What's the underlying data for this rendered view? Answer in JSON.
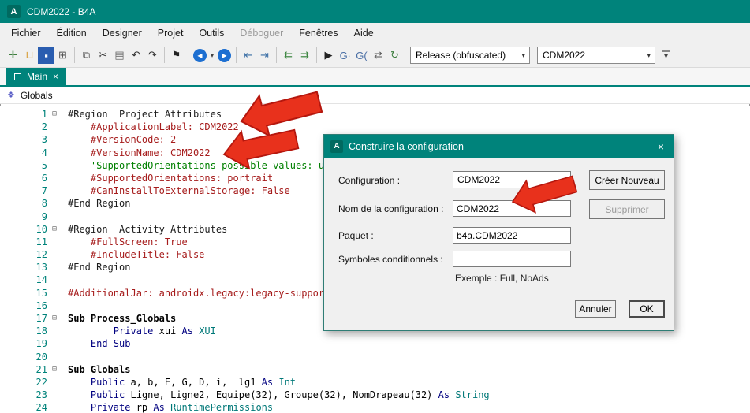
{
  "titlebar": {
    "logo": "A",
    "title": "CDM2022 - B4A"
  },
  "menu": {
    "items": [
      {
        "id": "fichier",
        "label": "Fichier",
        "enabled": true
      },
      {
        "id": "edition",
        "label": "Édition",
        "enabled": true
      },
      {
        "id": "designer",
        "label": "Designer",
        "enabled": true
      },
      {
        "id": "projet",
        "label": "Projet",
        "enabled": true
      },
      {
        "id": "outils",
        "label": "Outils",
        "enabled": true
      },
      {
        "id": "deboguer",
        "label": "Déboguer",
        "enabled": false
      },
      {
        "id": "fenetres",
        "label": "Fenêtres",
        "enabled": true
      },
      {
        "id": "aide",
        "label": "Aide",
        "enabled": true
      }
    ]
  },
  "toolbar": {
    "items": [
      {
        "type": "icon",
        "name": "new-module-icon",
        "glyph": "✛",
        "color": "#3c7d3c"
      },
      {
        "type": "icon",
        "name": "open-icon",
        "glyph": "⊔",
        "color": "#d79b33"
      },
      {
        "type": "icon",
        "name": "save-icon",
        "glyph": "▪",
        "color": "#ffffff",
        "bg": "#2a5db0"
      },
      {
        "type": "icon",
        "name": "modules-icon",
        "glyph": "⊞",
        "color": "#555555"
      },
      {
        "type": "sep"
      },
      {
        "type": "icon",
        "name": "copy-icon",
        "glyph": "⧉",
        "color": "#555555"
      },
      {
        "type": "icon",
        "name": "cut-icon",
        "glyph": "✂",
        "color": "#333333"
      },
      {
        "type": "icon",
        "name": "paste-icon",
        "glyph": "▤",
        "color": "#666666"
      },
      {
        "type": "icon",
        "name": "undo-icon",
        "glyph": "↶",
        "color": "#333333"
      },
      {
        "type": "icon",
        "name": "redo-icon",
        "glyph": "↷",
        "color": "#333333"
      },
      {
        "type": "sep"
      },
      {
        "type": "icon",
        "name": "bookmark-icon",
        "glyph": "⚑",
        "color": "#222222"
      },
      {
        "type": "sep"
      },
      {
        "type": "icon",
        "name": "navigate-back-icon",
        "glyph": "◀",
        "color": "#ffffff",
        "bg": "#1d6fd1",
        "round": true
      },
      {
        "type": "icon",
        "name": "back-dropdown-icon",
        "glyph": "▾",
        "color": "#444444",
        "small": true
      },
      {
        "type": "icon",
        "name": "navigate-forward-icon",
        "glyph": "▶",
        "color": "#ffffff",
        "bg": "#1d6fd1",
        "round": true
      },
      {
        "type": "sep"
      },
      {
        "type": "icon",
        "name": "outdent-icon",
        "glyph": "⇤",
        "color": "#3a6ea5"
      },
      {
        "type": "icon",
        "name": "indent-icon",
        "glyph": "⇥",
        "color": "#3a6ea5"
      },
      {
        "type": "sep"
      },
      {
        "type": "icon",
        "name": "comment-icon",
        "glyph": "⇇",
        "color": "#2e7d32"
      },
      {
        "type": "icon",
        "name": "uncomment-icon",
        "glyph": "⇉",
        "color": "#2e7d32"
      },
      {
        "type": "sep"
      },
      {
        "type": "icon",
        "name": "run-icon",
        "glyph": "▶",
        "color": "#222222"
      },
      {
        "type": "icon",
        "name": "goto-event-icon",
        "glyph": "G∙",
        "color": "#4a6fa5"
      },
      {
        "type": "icon",
        "name": "goto-sub-icon",
        "glyph": "G(",
        "color": "#4a6fa5"
      },
      {
        "type": "icon",
        "name": "switch-module-icon",
        "glyph": "⇄",
        "color": "#555555"
      },
      {
        "type": "icon",
        "name": "rebuild-icon",
        "glyph": "↻",
        "color": "#3a7d3c"
      },
      {
        "type": "combo",
        "name": "build-configuration-select",
        "value": "Release (obfuscated)",
        "width": 152
      },
      {
        "type": "combo",
        "name": "module-select",
        "value": "CDM2022",
        "width": 150
      },
      {
        "type": "overflow",
        "name": "toolbar-overflow-button",
        "glyph": "▾"
      }
    ]
  },
  "tabs": {
    "items": [
      {
        "id": "main",
        "label": "Main",
        "close": "×",
        "active": true
      }
    ]
  },
  "navbar": {
    "label": "Globals"
  },
  "editor": {
    "lines": [
      {
        "n": 1,
        "fold": true,
        "segs": [
          {
            "t": "#Region  Project Attributes",
            "c": "d"
          }
        ]
      },
      {
        "n": 2,
        "fold": false,
        "segs": [
          {
            "t": "    #ApplicationLabel: CDM2022",
            "c": "a"
          }
        ]
      },
      {
        "n": 3,
        "fold": false,
        "segs": [
          {
            "t": "    #VersionCode: 2",
            "c": "a"
          }
        ]
      },
      {
        "n": 4,
        "fold": false,
        "segs": [
          {
            "t": "    #VersionName: CDM2022",
            "c": "a"
          }
        ]
      },
      {
        "n": 5,
        "fold": false,
        "segs": [
          {
            "t": "    'SupportedOrientations possible values: un",
            "c": "c"
          }
        ]
      },
      {
        "n": 6,
        "fold": false,
        "segs": [
          {
            "t": "    #SupportedOrientations: portrait",
            "c": "a"
          }
        ]
      },
      {
        "n": 7,
        "fold": false,
        "segs": [
          {
            "t": "    #CanInstallToExternalStorage: False",
            "c": "a"
          }
        ]
      },
      {
        "n": 8,
        "fold": false,
        "segs": [
          {
            "t": "#End Region",
            "c": "d"
          }
        ]
      },
      {
        "n": 9,
        "fold": false,
        "segs": []
      },
      {
        "n": 10,
        "fold": true,
        "segs": [
          {
            "t": "#Region  Activity Attributes",
            "c": "d"
          }
        ]
      },
      {
        "n": 11,
        "fold": false,
        "segs": [
          {
            "t": "    #FullScreen: True",
            "c": "a"
          }
        ]
      },
      {
        "n": 12,
        "fold": false,
        "segs": [
          {
            "t": "    #IncludeTitle: False",
            "c": "a"
          }
        ]
      },
      {
        "n": 13,
        "fold": false,
        "segs": [
          {
            "t": "#End Region",
            "c": "d"
          }
        ]
      },
      {
        "n": 14,
        "fold": false,
        "segs": []
      },
      {
        "n": 15,
        "fold": false,
        "segs": [
          {
            "t": "#AdditionalJar: androidx.legacy:legacy-support",
            "c": "a"
          }
        ]
      },
      {
        "n": 16,
        "fold": false,
        "segs": []
      },
      {
        "n": 17,
        "fold": true,
        "segs": [
          {
            "t": "Sub Process_Globals",
            "c": "s"
          }
        ]
      },
      {
        "n": 18,
        "fold": false,
        "segs": [
          {
            "t": "        ",
            "c": "i"
          },
          {
            "t": "Private",
            "c": "k"
          },
          {
            "t": " xui ",
            "c": "i"
          },
          {
            "t": "As",
            "c": "k"
          },
          {
            "t": " ",
            "c": "i"
          },
          {
            "t": "XUI",
            "c": "t"
          }
        ]
      },
      {
        "n": 19,
        "fold": false,
        "segs": [
          {
            "t": "    ",
            "c": "i"
          },
          {
            "t": "End Sub",
            "c": "k"
          }
        ]
      },
      {
        "n": 20,
        "fold": false,
        "segs": []
      },
      {
        "n": 21,
        "fold": true,
        "segs": [
          {
            "t": "Sub Globals",
            "c": "s"
          }
        ]
      },
      {
        "n": 22,
        "fold": false,
        "segs": [
          {
            "t": "    ",
            "c": "i"
          },
          {
            "t": "Public",
            "c": "k"
          },
          {
            "t": " a, b, E, G, D, i,  lg1 ",
            "c": "i"
          },
          {
            "t": "As",
            "c": "k"
          },
          {
            "t": " ",
            "c": "i"
          },
          {
            "t": "Int",
            "c": "t"
          }
        ]
      },
      {
        "n": 23,
        "fold": false,
        "segs": [
          {
            "t": "    ",
            "c": "i"
          },
          {
            "t": "Public",
            "c": "k"
          },
          {
            "t": " Ligne, Ligne2, Equipe(32), Groupe(32), NomDrapeau(32) ",
            "c": "i"
          },
          {
            "t": "As",
            "c": "k"
          },
          {
            "t": " ",
            "c": "i"
          },
          {
            "t": "String",
            "c": "t"
          }
        ]
      },
      {
        "n": 24,
        "fold": false,
        "segs": [
          {
            "t": "    ",
            "c": "i"
          },
          {
            "t": "Private",
            "c": "k"
          },
          {
            "t": " rp ",
            "c": "i"
          },
          {
            "t": "As",
            "c": "k"
          },
          {
            "t": " ",
            "c": "i"
          },
          {
            "t": "RuntimePermissions",
            "c": "t"
          }
        ]
      }
    ]
  },
  "dialog": {
    "logo": "A",
    "title": "Construire la configuration",
    "close": "×",
    "fields": {
      "configuration_label": "Configuration :",
      "configuration_value": "CDM2022",
      "name_label": "Nom de la configuration :",
      "name_value": "CDM2022",
      "package_label": "Paquet :",
      "package_value": "b4a.CDM2022",
      "symbols_label": "Symboles conditionnels :",
      "symbols_value": "",
      "example_text": "Exemple : Full, NoAds"
    },
    "buttons": {
      "create": "Créer Nouveau",
      "delete": "Supprimer",
      "cancel": "Annuler",
      "ok": "OK"
    }
  },
  "colors": {
    "teal": "#00837B",
    "arrow_red": "#e8311c"
  }
}
